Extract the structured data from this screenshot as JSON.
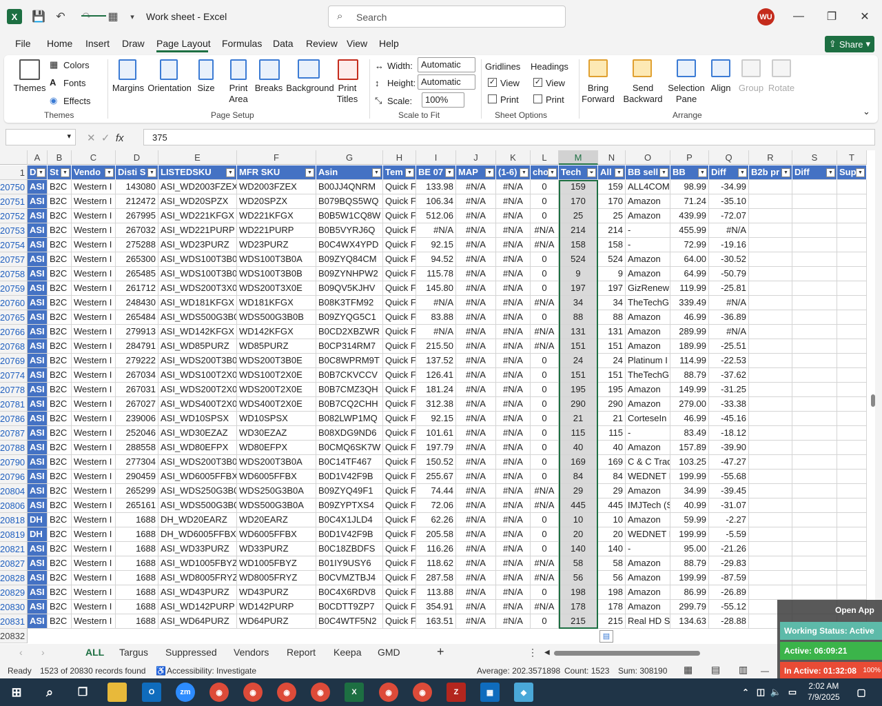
{
  "app": {
    "title": "Work sheet  -  Excel",
    "search_placeholder": "Search",
    "user_initials": "WU",
    "share_label": "Share"
  },
  "menu": [
    "File",
    "Home",
    "Insert",
    "Draw",
    "Page Layout",
    "Formulas",
    "Data",
    "Review",
    "View",
    "Help"
  ],
  "ribbon": {
    "themes": {
      "themes_label": "Themes",
      "colors_label": "Colors",
      "fonts_label": "Fonts",
      "effects_label": "Effects",
      "group_label": "Themes"
    },
    "page_setup": {
      "margins": "Margins",
      "orientation": "Orientation",
      "size": "Size",
      "print_area": "Print\nArea",
      "breaks": "Breaks",
      "background": "Background",
      "print_titles": "Print\nTitles",
      "group_label": "Page Setup"
    },
    "scale_to_fit": {
      "width_label": "Width:",
      "width_value": "Automatic",
      "height_label": "Height:",
      "height_value": "Automatic",
      "scale_label": "Scale:",
      "scale_value": "100%",
      "group_label": "Scale to Fit"
    },
    "sheet_options": {
      "gridlines": "Gridlines",
      "headings": "Headings",
      "view": "View",
      "print": "Print",
      "group_label": "Sheet Options"
    },
    "arrange": {
      "bring_forward": "Bring\nForward",
      "send_backward": "Send\nBackward",
      "selection_pane": "Selection\nPane",
      "align": "Align",
      "group": "Group",
      "rotate": "Rotate",
      "group_label": "Arrange"
    }
  },
  "formula_bar": {
    "name_box": "",
    "value": "375"
  },
  "columns": [
    "A",
    "B",
    "C",
    "D",
    "E",
    "F",
    "G",
    "H",
    "I",
    "J",
    "K",
    "L",
    "M",
    "N",
    "O",
    "P",
    "Q",
    "R",
    "S",
    "T"
  ],
  "header_row": [
    "D",
    "St",
    "Vendo",
    "Disti S",
    "LISTEDSKU",
    "MFR SKU",
    "Asin",
    "Tem",
    "BE 07",
    "MAP",
    "(1-6)",
    "cho",
    "Tech",
    "All",
    "BB sell",
    "BB",
    "Diff",
    "B2b pr",
    "Diff",
    "Sup"
  ],
  "header_row_number": "1",
  "rows": [
    [
      "20750",
      "ASI",
      "B2C",
      "Western I",
      "143080",
      "ASI_WD2003FZEX",
      "WD2003FZEX",
      "B00JJ4QNRM",
      "Quick F",
      "133.98",
      "#N/A",
      "#N/A",
      "0",
      "159",
      "159",
      "ALL4COMP",
      "98.99",
      "-34.99"
    ],
    [
      "20751",
      "ASI",
      "B2C",
      "Western I",
      "212472",
      "ASI_WD20SPZX",
      "WD20SPZX",
      "B079BQS5WQ",
      "Quick F",
      "106.34",
      "#N/A",
      "#N/A",
      "0",
      "170",
      "170",
      "Amazon",
      "71.24",
      "-35.10"
    ],
    [
      "20752",
      "ASI",
      "B2C",
      "Western I",
      "267995",
      "ASI_WD221KFGX",
      "WD221KFGX",
      "B0B5W1CQ8W",
      "Quick F",
      "512.06",
      "#N/A",
      "#N/A",
      "0",
      "25",
      "25",
      "Amazon",
      "439.99",
      "-72.07"
    ],
    [
      "20753",
      "ASI",
      "B2C",
      "Western I",
      "267032",
      "ASI_WD221PURP",
      "WD221PURP",
      "B0B5VYRJ6Q",
      "Quick F",
      "#N/A",
      "#N/A",
      "#N/A",
      "#N/A",
      "214",
      "214",
      "-",
      "455.99",
      "#N/A"
    ],
    [
      "20754",
      "ASI",
      "B2C",
      "Western I",
      "275288",
      "ASI_WD23PURZ",
      "WD23PURZ",
      "B0C4WX4YPD",
      "Quick F",
      "92.15",
      "#N/A",
      "#N/A",
      "#N/A",
      "158",
      "158",
      "-",
      "72.99",
      "-19.16"
    ],
    [
      "20757",
      "ASI",
      "B2C",
      "Western I",
      "265300",
      "ASI_WDS100T3B0A",
      "WDS100T3B0A",
      "B09ZYQ84CM",
      "Quick F",
      "94.52",
      "#N/A",
      "#N/A",
      "0",
      "524",
      "524",
      "Amazon",
      "64.00",
      "-30.52"
    ],
    [
      "20758",
      "ASI",
      "B2C",
      "Western I",
      "265485",
      "ASI_WDS100T3B0B",
      "WDS100T3B0B",
      "B09ZYNHPW2",
      "Quick F",
      "115.78",
      "#N/A",
      "#N/A",
      "0",
      "9",
      "9",
      "Amazon",
      "64.99",
      "-50.79"
    ],
    [
      "20759",
      "ASI",
      "B2C",
      "Western I",
      "261712",
      "ASI_WDS200T3X0E",
      "WDS200T3X0E",
      "B09QV5KJHV",
      "Quick F",
      "145.80",
      "#N/A",
      "#N/A",
      "0",
      "197",
      "197",
      "GizRenew",
      "119.99",
      "-25.81"
    ],
    [
      "20760",
      "ASI",
      "B2C",
      "Western I",
      "248430",
      "ASI_WD181KFGX",
      "WD181KFGX",
      "B08K3TFM92",
      "Quick F",
      "#N/A",
      "#N/A",
      "#N/A",
      "#N/A",
      "34",
      "34",
      "TheTechG",
      "339.49",
      "#N/A"
    ],
    [
      "20765",
      "ASI",
      "B2C",
      "Western I",
      "265484",
      "ASI_WDS500G3B0B",
      "WDS500G3B0B",
      "B09ZYQG5C1",
      "Quick F",
      "83.88",
      "#N/A",
      "#N/A",
      "0",
      "88",
      "88",
      "Amazon",
      "46.99",
      "-36.89"
    ],
    [
      "20766",
      "ASI",
      "B2C",
      "Western I",
      "279913",
      "ASI_WD142KFGX",
      "WD142KFGX",
      "B0CD2XBZWR",
      "Quick F",
      "#N/A",
      "#N/A",
      "#N/A",
      "#N/A",
      "131",
      "131",
      "Amazon",
      "289.99",
      "#N/A"
    ],
    [
      "20768",
      "ASI",
      "B2C",
      "Western I",
      "284791",
      "ASI_WD85PURZ",
      "WD85PURZ",
      "B0CP314RM7",
      "Quick F",
      "215.50",
      "#N/A",
      "#N/A",
      "#N/A",
      "151",
      "151",
      "Amazon",
      "189.99",
      "-25.51"
    ],
    [
      "20769",
      "ASI",
      "B2C",
      "Western I",
      "279222",
      "ASI_WDS200T3B0E",
      "WDS200T3B0E",
      "B0C8WPRM9T",
      "Quick F",
      "137.52",
      "#N/A",
      "#N/A",
      "0",
      "24",
      "24",
      "Platinum I",
      "114.99",
      "-22.53"
    ],
    [
      "20774",
      "ASI",
      "B2C",
      "Western I",
      "267034",
      "ASI_WDS100T2X0E",
      "WDS100T2X0E",
      "B0B7CKVCCV",
      "Quick F",
      "126.41",
      "#N/A",
      "#N/A",
      "0",
      "151",
      "151",
      "TheTechG",
      "88.79",
      "-37.62"
    ],
    [
      "20778",
      "ASI",
      "B2C",
      "Western I",
      "267031",
      "ASI_WDS200T2X0E",
      "WDS200T2X0E",
      "B0B7CMZ3QH",
      "Quick F",
      "181.24",
      "#N/A",
      "#N/A",
      "0",
      "195",
      "195",
      "Amazon",
      "149.99",
      "-31.25"
    ],
    [
      "20781",
      "ASI",
      "B2C",
      "Western I",
      "267027",
      "ASI_WDS400T2X0E",
      "WDS400T2X0E",
      "B0B7CQ2CHH",
      "Quick F",
      "312.38",
      "#N/A",
      "#N/A",
      "0",
      "290",
      "290",
      "Amazon",
      "279.00",
      "-33.38"
    ],
    [
      "20786",
      "ASI",
      "B2C",
      "Western I",
      "239006",
      "ASI_WD10SPSX",
      "WD10SPSX",
      "B082LWP1MQ",
      "Quick F",
      "92.15",
      "#N/A",
      "#N/A",
      "0",
      "21",
      "21",
      "CorteseIn",
      "46.99",
      "-45.16"
    ],
    [
      "20787",
      "ASI",
      "B2C",
      "Western I",
      "252046",
      "ASI_WD30EZAZ",
      "WD30EZAZ",
      "B08XDG9ND6",
      "Quick F",
      "101.61",
      "#N/A",
      "#N/A",
      "0",
      "115",
      "115",
      "-",
      "83.49",
      "-18.12"
    ],
    [
      "20788",
      "ASI",
      "B2C",
      "Western I",
      "288558",
      "ASI_WD80EFPX",
      "WD80EFPX",
      "B0CMQ6SK7W",
      "Quick F",
      "197.79",
      "#N/A",
      "#N/A",
      "0",
      "40",
      "40",
      "Amazon",
      "157.89",
      "-39.90"
    ],
    [
      "20790",
      "ASI",
      "B2C",
      "Western I",
      "277304",
      "ASI_WDS200T3B0A",
      "WDS200T3B0A",
      "B0C14TF467",
      "Quick F",
      "150.52",
      "#N/A",
      "#N/A",
      "0",
      "169",
      "169",
      "C & C Trad",
      "103.25",
      "-47.27"
    ],
    [
      "20796",
      "ASI",
      "B2C",
      "Western I",
      "290459",
      "ASI_WD6005FFBX",
      "WD6005FFBX",
      "B0D1V42F9B",
      "Quick F",
      "255.67",
      "#N/A",
      "#N/A",
      "0",
      "84",
      "84",
      "WEDNET L",
      "199.99",
      "-55.68"
    ],
    [
      "20804",
      "ASI",
      "B2C",
      "Western I",
      "265299",
      "ASI_WDS250G3B0A",
      "WDS250G3B0A",
      "B09ZYQ49F1",
      "Quick F",
      "74.44",
      "#N/A",
      "#N/A",
      "#N/A",
      "29",
      "29",
      "Amazon",
      "34.99",
      "-39.45"
    ],
    [
      "20806",
      "ASI",
      "B2C",
      "Western I",
      "265161",
      "ASI_WDS500G3B0A",
      "WDS500G3B0A",
      "B09ZYPTXS4",
      "Quick F",
      "72.06",
      "#N/A",
      "#N/A",
      "#N/A",
      "445",
      "445",
      "IMJTech (S",
      "40.99",
      "-31.07"
    ],
    [
      "20818",
      "DH",
      "B2C",
      "Western I",
      "1688",
      "DH_WD20EARZ",
      "WD20EARZ",
      "B0C4X1JLD4",
      "Quick F",
      "62.26",
      "#N/A",
      "#N/A",
      "0",
      "10",
      "10",
      "Amazon",
      "59.99",
      "-2.27"
    ],
    [
      "20819",
      "DH",
      "B2C",
      "Western I",
      "1688",
      "DH_WD6005FFBX",
      "WD6005FFBX",
      "B0D1V42F9B",
      "Quick F",
      "205.58",
      "#N/A",
      "#N/A",
      "0",
      "20",
      "20",
      "WEDNET L",
      "199.99",
      "-5.59"
    ],
    [
      "20821",
      "ASI",
      "B2C",
      "Western I",
      "1688",
      "ASI_WD33PURZ",
      "WD33PURZ",
      "B0C18ZBDFS",
      "Quick F",
      "116.26",
      "#N/A",
      "#N/A",
      "0",
      "140",
      "140",
      "-",
      "95.00",
      "-21.26"
    ],
    [
      "20827",
      "ASI",
      "B2C",
      "Western I",
      "1688",
      "ASI_WD1005FBYZ",
      "WD1005FBYZ",
      "B01IY9USY6",
      "Quick F",
      "118.62",
      "#N/A",
      "#N/A",
      "#N/A",
      "58",
      "58",
      "Amazon",
      "88.79",
      "-29.83"
    ],
    [
      "20828",
      "ASI",
      "B2C",
      "Western I",
      "1688",
      "ASI_WD8005FRYZ",
      "WD8005FRYZ",
      "B0CVMZTBJ4",
      "Quick F",
      "287.58",
      "#N/A",
      "#N/A",
      "#N/A",
      "56",
      "56",
      "Amazon",
      "199.99",
      "-87.59"
    ],
    [
      "20829",
      "ASI",
      "B2C",
      "Western I",
      "1688",
      "ASI_WD43PURZ",
      "WD43PURZ",
      "B0C4X6RDV8",
      "Quick F",
      "113.88",
      "#N/A",
      "#N/A",
      "0",
      "198",
      "198",
      "Amazon",
      "86.99",
      "-26.89"
    ],
    [
      "20830",
      "ASI",
      "B2C",
      "Western I",
      "1688",
      "ASI_WD142PURP",
      "WD142PURP",
      "B0CDTT9ZP7",
      "Quick F",
      "354.91",
      "#N/A",
      "#N/A",
      "#N/A",
      "178",
      "178",
      "Amazon",
      "299.79",
      "-55.12"
    ],
    [
      "20831",
      "ASI",
      "B2C",
      "Western I",
      "1688",
      "ASI_WD64PURZ",
      "WD64PURZ",
      "B0C4WTF5N2",
      "Quick F",
      "163.51",
      "#N/A",
      "#N/A",
      "0",
      "215",
      "215",
      "Real HD St",
      "134.63",
      "-28.88"
    ]
  ],
  "last_row_number": "20832",
  "sheet_tabs": [
    "ALL",
    "Targus",
    "Suppressed",
    "Vendors",
    "Report",
    "Keepa",
    "GMD"
  ],
  "status": {
    "ready": "Ready",
    "records": "1523 of 20830 records found",
    "accessibility": "Accessibility: Investigate",
    "average": "Average: 202.3571898",
    "count": "Count: 1523",
    "sum": "Sum: 308190"
  },
  "overlay": {
    "open_app": "Open App",
    "working_status": "Working Status: Active",
    "active": "Active: 06:09:21",
    "inactive": "In Active: 01:32:08",
    "zoom_fragment": "100%"
  },
  "taskbar": {
    "time": "2:02 AM",
    "date": "7/9/2025"
  }
}
